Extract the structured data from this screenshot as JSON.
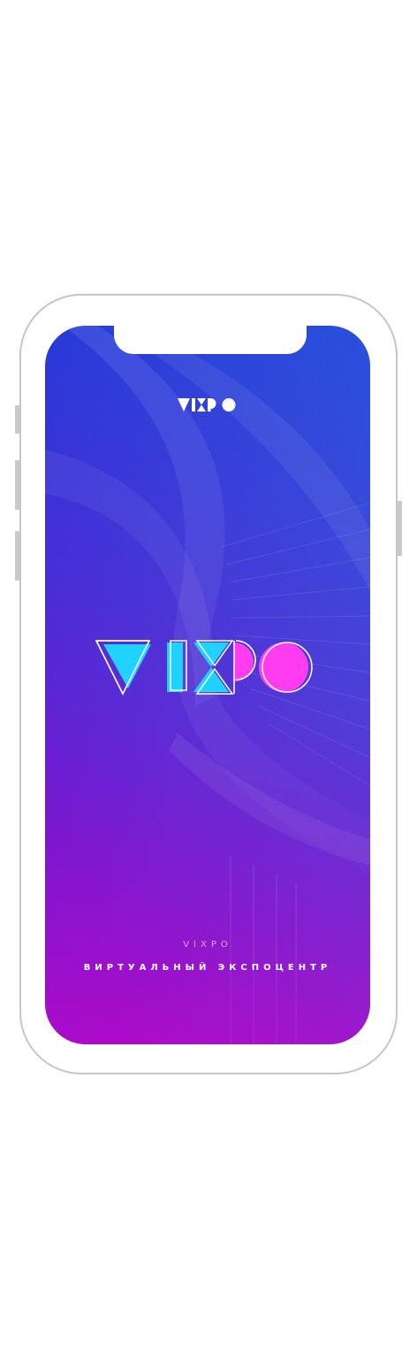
{
  "app": {
    "logo_small_alt": "VIXPO",
    "logo_main_alt": "VIXPO",
    "brand_name": "VIXPO",
    "tagline": "ВИРТУАЛЬНЫЙ ЭКСПОЦЕНТР"
  },
  "colors": {
    "cyan": "#1fd2ff",
    "magenta": "#ff3cf0",
    "gradient_top": "#2a30d6",
    "gradient_bottom": "#b10ac9"
  },
  "icons": {
    "small_logo": "vixpo-logo-icon",
    "main_logo": "vixpo-logo-large"
  }
}
